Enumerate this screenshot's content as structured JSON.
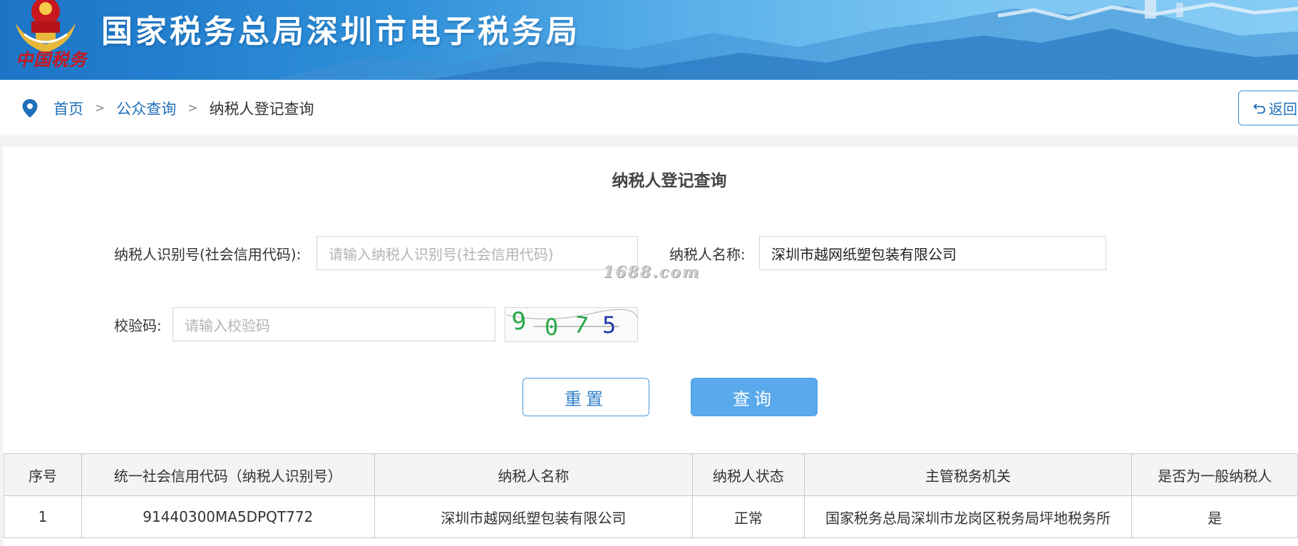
{
  "header": {
    "title": "国家税务总局深圳市电子税务局",
    "brand_script": "中国税务",
    "colors": {
      "banner_start": "#1c74c6",
      "banner_end": "#86ccf4",
      "emblem_red": "#c8171e",
      "emblem_gold": "#e8b83a"
    }
  },
  "breadcrumb": {
    "items": [
      {
        "label": "首页"
      },
      {
        "label": "公众查询"
      },
      {
        "label": "纳税人登记查询"
      }
    ],
    "separator": ">",
    "back_label": "返回"
  },
  "form": {
    "title": "纳税人登记查询",
    "taxpayer_id": {
      "label": "纳税人识别号(社会信用代码):",
      "placeholder": "请输入纳税人识别号(社会信用代码)",
      "value": ""
    },
    "taxpayer_name": {
      "label": "纳税人名称:",
      "placeholder": "",
      "value": "深圳市越网纸塑包装有限公司"
    },
    "captcha": {
      "label": "校验码:",
      "placeholder": "请输入校验码",
      "value": "",
      "digits": [
        "9",
        "0",
        "7",
        "5"
      ]
    },
    "reset_label": "重置",
    "query_label": "查询",
    "watermark": "1688.com",
    "accent_color": "#5aa9ec"
  },
  "results": {
    "columns": [
      "序号",
      "统一社会信用代码（纳税人识别号）",
      "纳税人名称",
      "纳税人状态",
      "主管税务机关",
      "是否为一般纳税人"
    ],
    "rows": [
      [
        "1",
        "91440300MA5DPQT772",
        "深圳市越网纸塑包装有限公司",
        "正常",
        "国家税务总局深圳市龙岗区税务局坪地税务所",
        "是"
      ]
    ]
  }
}
